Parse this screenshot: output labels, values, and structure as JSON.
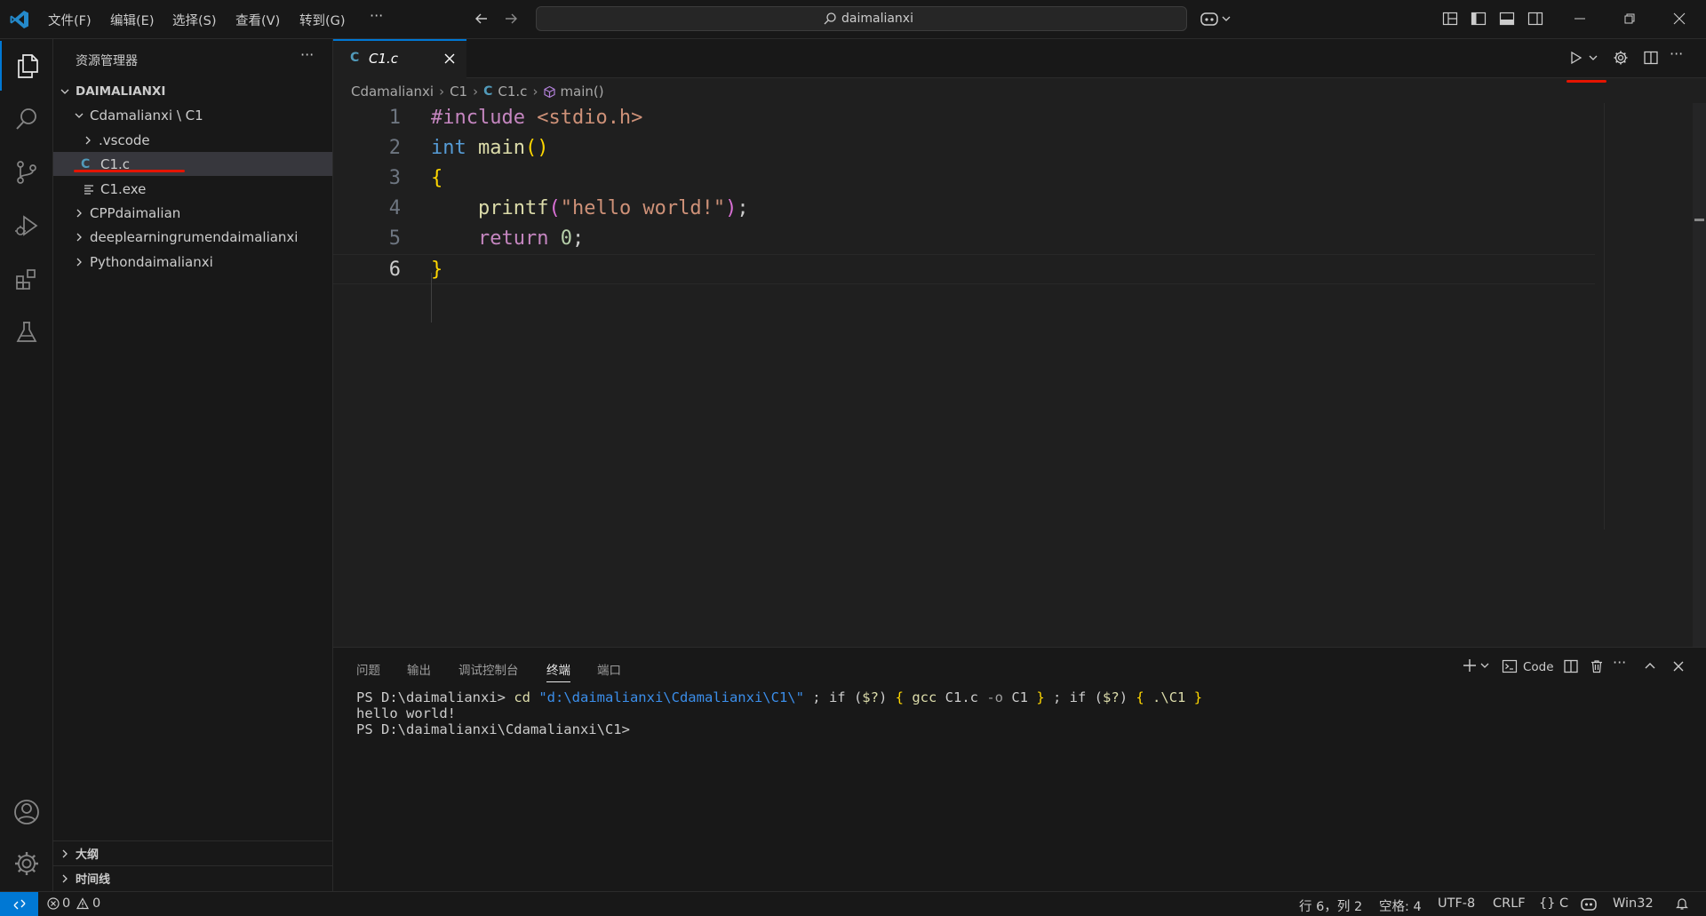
{
  "colors": {
    "accent": "#0078d4",
    "c_icon": "#519aba",
    "annotation": "#e51400"
  },
  "titlebar": {
    "menus": [
      "文件(F)",
      "编辑(E)",
      "选择(S)",
      "查看(V)",
      "转到(G)"
    ],
    "more": "···",
    "search_text": "daimalianxi"
  },
  "sidebar": {
    "title": "资源管理器",
    "more": "···",
    "workspace": "DAIMALIANXI",
    "tree": [
      {
        "label": "Cdamalianxi \\ C1",
        "expanded": true
      },
      {
        "label": ".vscode",
        "expanded": false
      },
      {
        "label": "C1.c",
        "icon": "C",
        "selected": true
      },
      {
        "label": "C1.exe"
      },
      {
        "label": "CPPdaimalian",
        "expanded": false
      },
      {
        "label": "deeplearningrumendaimalianxi",
        "expanded": false
      },
      {
        "label": "Pythondaimalianxi",
        "expanded": false
      }
    ],
    "outline": "大纲",
    "timeline": "时间线"
  },
  "editor": {
    "tab_icon": "C",
    "tab_label": "C1.c",
    "breadcrumb": [
      "Cdamalianxi",
      "C1",
      "C1.c",
      "main()"
    ],
    "lines": [
      {
        "n": "1",
        "tokens": [
          {
            "t": "#include ",
            "c": "kw-inc"
          },
          {
            "t": "<stdio.h>",
            "c": "str"
          }
        ]
      },
      {
        "n": "2",
        "tokens": [
          {
            "t": "int",
            "c": "type"
          },
          {
            "t": " ",
            "c": "punct"
          },
          {
            "t": "main",
            "c": "fn"
          },
          {
            "t": "()",
            "c": "brace"
          }
        ]
      },
      {
        "n": "3",
        "tokens": [
          {
            "t": "{",
            "c": "brace"
          }
        ]
      },
      {
        "n": "4",
        "tokens": [
          {
            "t": "    ",
            "c": "punct"
          },
          {
            "t": "printf",
            "c": "fn"
          },
          {
            "t": "(",
            "c": "paren"
          },
          {
            "t": "\"hello world!\"",
            "c": "str"
          },
          {
            "t": ")",
            "c": "paren"
          },
          {
            "t": ";",
            "c": "punct"
          }
        ]
      },
      {
        "n": "5",
        "tokens": [
          {
            "t": "    ",
            "c": "punct"
          },
          {
            "t": "return",
            "c": "kw-inc"
          },
          {
            "t": " ",
            "c": "punct"
          },
          {
            "t": "0",
            "c": "num"
          },
          {
            "t": ";",
            "c": "punct"
          }
        ]
      },
      {
        "n": "6",
        "tokens": [
          {
            "t": "}",
            "c": "brace"
          }
        ]
      }
    ],
    "current_line": "6"
  },
  "panel": {
    "tabs": [
      "问题",
      "输出",
      "调试控制台",
      "终端",
      "端口"
    ],
    "active_tab": "终端",
    "terminal_profile": "Code",
    "terminal": [
      [
        {
          "t": "PS D:\\daimalianxi> ",
          "c": ""
        },
        {
          "t": "cd",
          "c": "t-cmd"
        },
        {
          "t": " ",
          "c": ""
        },
        {
          "t": "\"d:\\daimalianxi\\Cdamalianxi\\C1\\\"",
          "c": "t-str"
        },
        {
          "t": " ; ",
          "c": ""
        },
        {
          "t": "if",
          "c": "t-kw"
        },
        {
          "t": " (",
          "c": ""
        },
        {
          "t": "$?",
          "c": "t-cmd"
        },
        {
          "t": ") ",
          "c": ""
        },
        {
          "t": "{",
          "c": "t-br"
        },
        {
          "t": " ",
          "c": ""
        },
        {
          "t": "gcc",
          "c": "t-cmd"
        },
        {
          "t": " C1.c ",
          "c": ""
        },
        {
          "t": "-o",
          "c": "t-op"
        },
        {
          "t": " C1 ",
          "c": ""
        },
        {
          "t": "}",
          "c": "t-br"
        },
        {
          "t": " ; ",
          "c": ""
        },
        {
          "t": "if",
          "c": "t-kw"
        },
        {
          "t": " (",
          "c": ""
        },
        {
          "t": "$?",
          "c": "t-cmd"
        },
        {
          "t": ") ",
          "c": ""
        },
        {
          "t": "{",
          "c": "t-br"
        },
        {
          "t": " ",
          "c": ""
        },
        {
          "t": ".\\C1",
          "c": "t-cmd"
        },
        {
          "t": " ",
          "c": ""
        },
        {
          "t": "}",
          "c": "t-br"
        }
      ],
      [
        {
          "t": "hello world!",
          "c": ""
        }
      ],
      [
        {
          "t": "PS D:\\daimalianxi\\Cdamalianxi\\C1>",
          "c": ""
        }
      ]
    ]
  },
  "statusbar": {
    "errors": "0",
    "warnings": "0",
    "position": "行 6，列 2",
    "spaces": "空格: 4",
    "encoding": "UTF-8",
    "eol": "CRLF",
    "language": "{} C",
    "platform": "Win32"
  }
}
